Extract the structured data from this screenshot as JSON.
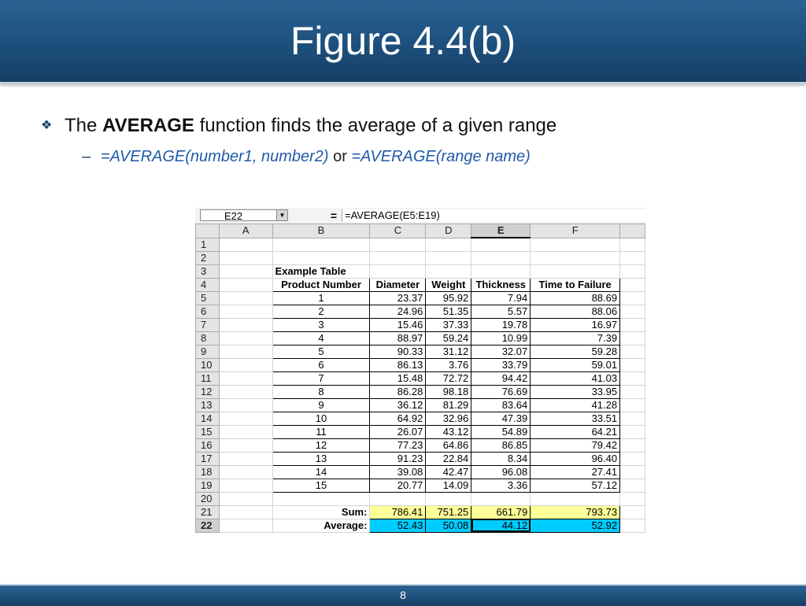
{
  "slide": {
    "title": "Figure 4.4(b)",
    "page_number": "8",
    "bullet": {
      "pre": "The ",
      "bold": "AVERAGE",
      "post": " function finds the average of a given range"
    },
    "sub_bullet": {
      "dash": "–",
      "part1": "=AVERAGE(number1, number2)",
      "or": " or ",
      "part2": "=AVERAGE(range name)"
    }
  },
  "spreadsheet": {
    "name_box": "E22",
    "equals": "=",
    "formula": "=AVERAGE(E5:E19)",
    "columns": [
      "A",
      "B",
      "C",
      "D",
      "E",
      "F"
    ],
    "row_numbers": [
      "1",
      "2",
      "3",
      "4",
      "5",
      "6",
      "7",
      "8",
      "9",
      "10",
      "11",
      "12",
      "13",
      "14",
      "15",
      "16",
      "17",
      "18",
      "19",
      "20",
      "21",
      "22"
    ],
    "table_title": "Example Table",
    "headers": [
      "Product Number",
      "Diameter",
      "Weight",
      "Thickness",
      "Time to Failure"
    ],
    "rows": [
      [
        "1",
        "23.37",
        "95.92",
        "7.94",
        "88.69"
      ],
      [
        "2",
        "24.96",
        "51.35",
        "5.57",
        "88.06"
      ],
      [
        "3",
        "15.46",
        "37.33",
        "19.78",
        "16.97"
      ],
      [
        "4",
        "88.97",
        "59.24",
        "10.99",
        "7.39"
      ],
      [
        "5",
        "90.33",
        "31.12",
        "32.07",
        "59.28"
      ],
      [
        "6",
        "86.13",
        "3.76",
        "33.79",
        "59.01"
      ],
      [
        "7",
        "15.48",
        "72.72",
        "94.42",
        "41.03"
      ],
      [
        "8",
        "86.28",
        "98.18",
        "76.69",
        "33.95"
      ],
      [
        "9",
        "36.12",
        "81.29",
        "83.64",
        "41.28"
      ],
      [
        "10",
        "64.92",
        "32.96",
        "47.39",
        "33.51"
      ],
      [
        "11",
        "26.07",
        "43.12",
        "54.89",
        "64.21"
      ],
      [
        "12",
        "77.23",
        "64.86",
        "86.85",
        "79.42"
      ],
      [
        "13",
        "91.23",
        "22.84",
        "8.34",
        "96.40"
      ],
      [
        "14",
        "39.08",
        "42.47",
        "96.08",
        "27.41"
      ],
      [
        "15",
        "20.77",
        "14.09",
        "3.36",
        "57.12"
      ]
    ],
    "sum_label": "Sum:",
    "sums": [
      "786.41",
      "751.25",
      "661.79",
      "793.73"
    ],
    "average_label": "Average:",
    "averages": [
      "52.43",
      "50.08",
      "44.12",
      "52.92"
    ],
    "colors": {
      "sum_fill": "#ffff99",
      "average_fill": "#00ccff"
    }
  }
}
